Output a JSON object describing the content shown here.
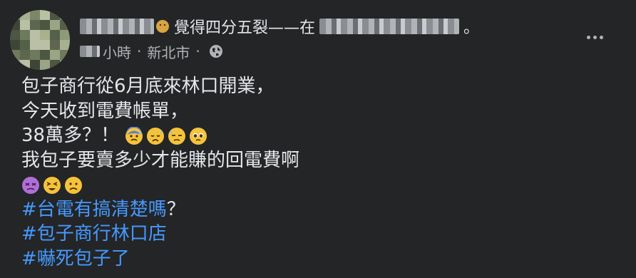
{
  "post": {
    "author_name": "",
    "action_text": "覺得四分五裂——在",
    "location_name": "",
    "end_punct": "。",
    "time_unit": "小時",
    "separator": "·",
    "location": "新北市",
    "separator2": "·",
    "privacy_icon": "globe-icon",
    "lines": [
      {
        "text": "包子商行從6月底來林口開業，",
        "type": "text"
      },
      {
        "text": "今天收到電費帳單，",
        "type": "text"
      },
      {
        "text": "38萬多？！",
        "type": "text-emoji",
        "emojis": [
          "anxious-sweat-face",
          "sad-relieved-face",
          "downcast-sweat-face",
          "pleading-face"
        ]
      },
      {
        "text": "我包子要賣多少才能賺的回電費啊",
        "type": "text"
      },
      {
        "text": "",
        "type": "emoji",
        "emojis": [
          "dizzy-purple-face",
          "tired-face",
          "frowning-face"
        ]
      },
      {
        "text": "#台電有搞清楚嗎",
        "suffix": "？",
        "type": "hashtag"
      },
      {
        "text": "#包子商行林口店",
        "type": "hashtag"
      },
      {
        "text": "#嚇死包子了",
        "type": "hashtag"
      }
    ]
  },
  "colors": {
    "background": "#242526",
    "text": "#e4e6eb",
    "secondary": "#b0b3b8",
    "hashtag": "#4599ff"
  }
}
